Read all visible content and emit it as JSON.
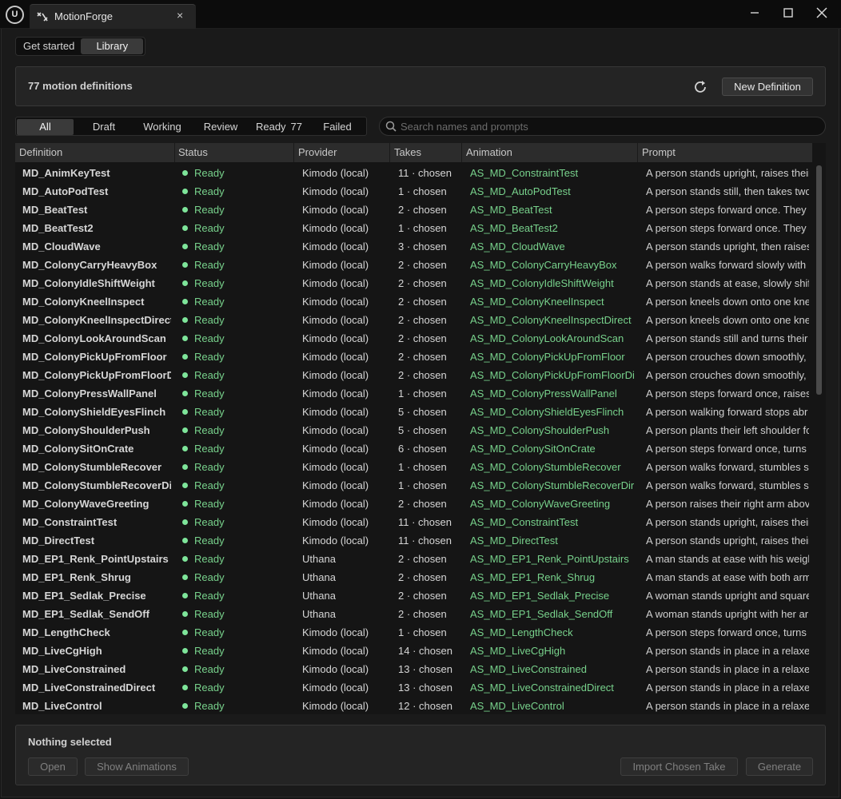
{
  "titlebar": {
    "logo": "U",
    "tab_title": "MotionForge",
    "tab_icon": "motion-icon",
    "close_glyph": "×",
    "minimize_glyph": "—",
    "maximize_glyph": "☐",
    "window_close_glyph": "✕"
  },
  "nav": {
    "get_started": "Get started",
    "library": "Library"
  },
  "summary": {
    "text": "77 motion definitions",
    "new_definition": "New Definition"
  },
  "filters": {
    "all": "All",
    "draft": "Draft",
    "working": "Working",
    "review": "Review",
    "ready": "Ready",
    "ready_count": "77",
    "failed": "Failed"
  },
  "search": {
    "placeholder": "Search names and prompts"
  },
  "table": {
    "headers": {
      "definition": "Definition",
      "status": "Status",
      "provider": "Provider",
      "takes": "Takes",
      "animation": "Animation",
      "prompt": "Prompt"
    },
    "rows": [
      {
        "def": "MD_AnimKeyTest",
        "status": "Ready",
        "provider": "Kimodo (local)",
        "takes": "11 · chosen",
        "anim": "AS_MD_ConstraintTest",
        "prompt": "A person stands upright, raises their"
      },
      {
        "def": "MD_AutoPodTest",
        "status": "Ready",
        "provider": "Kimodo (local)",
        "takes": "1 · chosen",
        "anim": "AS_MD_AutoPodTest",
        "prompt": "A person stands still, then takes two"
      },
      {
        "def": "MD_BeatTest",
        "status": "Ready",
        "provider": "Kimodo (local)",
        "takes": "2 · chosen",
        "anim": "AS_MD_BeatTest",
        "prompt": "A person steps forward once. They l"
      },
      {
        "def": "MD_BeatTest2",
        "status": "Ready",
        "provider": "Kimodo (local)",
        "takes": "1 · chosen",
        "anim": "AS_MD_BeatTest2",
        "prompt": "A person steps forward once. They l"
      },
      {
        "def": "MD_CloudWave",
        "status": "Ready",
        "provider": "Kimodo (local)",
        "takes": "3 · chosen",
        "anim": "AS_MD_CloudWave",
        "prompt": "A person stands upright, then raises"
      },
      {
        "def": "MD_ColonyCarryHeavyBox",
        "status": "Ready",
        "provider": "Kimodo (local)",
        "takes": "2 · chosen",
        "anim": "AS_MD_ColonyCarryHeavyBox",
        "prompt": "A person walks forward slowly with"
      },
      {
        "def": "MD_ColonyIdleShiftWeight",
        "status": "Ready",
        "provider": "Kimodo (local)",
        "takes": "2 · chosen",
        "anim": "AS_MD_ColonyIdleShiftWeight",
        "prompt": "A person stands at ease, slowly shif"
      },
      {
        "def": "MD_ColonyKneelInspect",
        "status": "Ready",
        "provider": "Kimodo (local)",
        "takes": "2 · chosen",
        "anim": "AS_MD_ColonyKneelInspect",
        "prompt": "A person kneels down onto one knee"
      },
      {
        "def": "MD_ColonyKneelInspectDirect",
        "status": "Ready",
        "provider": "Kimodo (local)",
        "takes": "2 · chosen",
        "anim": "AS_MD_ColonyKneelInspectDirect",
        "prompt": "A person kneels down onto one knee"
      },
      {
        "def": "MD_ColonyLookAroundScan",
        "status": "Ready",
        "provider": "Kimodo (local)",
        "takes": "2 · chosen",
        "anim": "AS_MD_ColonyLookAroundScan",
        "prompt": "A person stands still and turns their"
      },
      {
        "def": "MD_ColonyPickUpFromFloor",
        "status": "Ready",
        "provider": "Kimodo (local)",
        "takes": "2 · chosen",
        "anim": "AS_MD_ColonyPickUpFromFloor",
        "prompt": "A person crouches down smoothly,"
      },
      {
        "def": "MD_ColonyPickUpFromFloorDire",
        "status": "Ready",
        "provider": "Kimodo (local)",
        "takes": "2 · chosen",
        "anim": "AS_MD_ColonyPickUpFromFloorDir",
        "prompt": "A person crouches down smoothly,"
      },
      {
        "def": "MD_ColonyPressWallPanel",
        "status": "Ready",
        "provider": "Kimodo (local)",
        "takes": "1 · chosen",
        "anim": "AS_MD_ColonyPressWallPanel",
        "prompt": "A person steps forward once, raises"
      },
      {
        "def": "MD_ColonyShieldEyesFlinch",
        "status": "Ready",
        "provider": "Kimodo (local)",
        "takes": "5 · chosen",
        "anim": "AS_MD_ColonyShieldEyesFlinch",
        "prompt": "A person walking forward stops abr"
      },
      {
        "def": "MD_ColonyShoulderPush",
        "status": "Ready",
        "provider": "Kimodo (local)",
        "takes": "5 · chosen",
        "anim": "AS_MD_ColonyShoulderPush",
        "prompt": "A person plants their left shoulder fo"
      },
      {
        "def": "MD_ColonySitOnCrate",
        "status": "Ready",
        "provider": "Kimodo (local)",
        "takes": "6 · chosen",
        "anim": "AS_MD_ColonySitOnCrate",
        "prompt": "A person steps forward once, turns"
      },
      {
        "def": "MD_ColonyStumbleRecover",
        "status": "Ready",
        "provider": "Kimodo (local)",
        "takes": "1 · chosen",
        "anim": "AS_MD_ColonyStumbleRecover",
        "prompt": "A person walks forward, stumbles s"
      },
      {
        "def": "MD_ColonyStumbleRecoverDire",
        "status": "Ready",
        "provider": "Kimodo (local)",
        "takes": "1 · chosen",
        "anim": "AS_MD_ColonyStumbleRecoverDire",
        "prompt": "A person walks forward, stumbles s"
      },
      {
        "def": "MD_ColonyWaveGreeting",
        "status": "Ready",
        "provider": "Kimodo (local)",
        "takes": "2 · chosen",
        "anim": "AS_MD_ColonyWaveGreeting",
        "prompt": "A person raises their right arm abov"
      },
      {
        "def": "MD_ConstraintTest",
        "status": "Ready",
        "provider": "Kimodo (local)",
        "takes": "11 · chosen",
        "anim": "AS_MD_ConstraintTest",
        "prompt": "A person stands upright, raises their"
      },
      {
        "def": "MD_DirectTest",
        "status": "Ready",
        "provider": "Kimodo (local)",
        "takes": "11 · chosen",
        "anim": "AS_MD_DirectTest",
        "prompt": "A person stands upright, raises their"
      },
      {
        "def": "MD_EP1_Renk_PointUpstairs",
        "status": "Ready",
        "provider": "Uthana",
        "takes": "2 · chosen",
        "anim": "AS_MD_EP1_Renk_PointUpstairs",
        "prompt": "A man stands at ease with his weigh"
      },
      {
        "def": "MD_EP1_Renk_Shrug",
        "status": "Ready",
        "provider": "Uthana",
        "takes": "2 · chosen",
        "anim": "AS_MD_EP1_Renk_Shrug",
        "prompt": "A man stands at ease with both arm"
      },
      {
        "def": "MD_EP1_Sedlak_Precise",
        "status": "Ready",
        "provider": "Uthana",
        "takes": "2 · chosen",
        "anim": "AS_MD_EP1_Sedlak_Precise",
        "prompt": "A woman stands upright and square"
      },
      {
        "def": "MD_EP1_Sedlak_SendOff",
        "status": "Ready",
        "provider": "Uthana",
        "takes": "2 · chosen",
        "anim": "AS_MD_EP1_Sedlak_SendOff",
        "prompt": "A woman stands upright with her arı"
      },
      {
        "def": "MD_LengthCheck",
        "status": "Ready",
        "provider": "Kimodo (local)",
        "takes": "1 · chosen",
        "anim": "AS_MD_LengthCheck",
        "prompt": "A person steps forward once, turns"
      },
      {
        "def": "MD_LiveCgHigh",
        "status": "Ready",
        "provider": "Kimodo (local)",
        "takes": "14 · chosen",
        "anim": "AS_MD_LiveCgHigh",
        "prompt": "A person stands in place in a relaxe"
      },
      {
        "def": "MD_LiveConstrained",
        "status": "Ready",
        "provider": "Kimodo (local)",
        "takes": "13 · chosen",
        "anim": "AS_MD_LiveConstrained",
        "prompt": "A person stands in place in a relaxe"
      },
      {
        "def": "MD_LiveConstrainedDirect",
        "status": "Ready",
        "provider": "Kimodo (local)",
        "takes": "13 · chosen",
        "anim": "AS_MD_LiveConstrainedDirect",
        "prompt": "A person stands in place in a relaxe"
      },
      {
        "def": "MD_LiveControl",
        "status": "Ready",
        "provider": "Kimodo (local)",
        "takes": "12 · chosen",
        "anim": "AS_MD_LiveControl",
        "prompt": "A person stands in place in a relaxe"
      }
    ]
  },
  "footer": {
    "selection": "Nothing selected",
    "open": "Open",
    "show_animations": "Show Animations",
    "import_chosen_take": "Import Chosen Take",
    "generate": "Generate"
  },
  "colors": {
    "ready_green": "#7ee59a",
    "link_green": "#78d28c",
    "background": "#1a1a1a"
  },
  "icons": {
    "refresh": "refresh-icon",
    "search": "search-icon"
  }
}
